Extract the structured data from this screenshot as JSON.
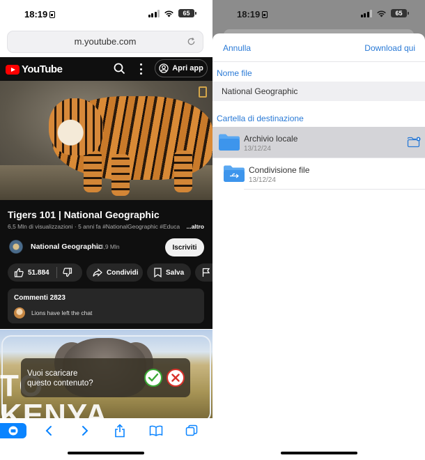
{
  "status": {
    "time": "18:19",
    "battery": "65"
  },
  "browser": {
    "url": "m.youtube.com"
  },
  "youtube": {
    "logo_text": "YouTube",
    "open_app_label": "Apri app",
    "video_title": "Tigers 101 | National Geographic",
    "video_meta": "6,5 Mln di visualizzazioni · 5 anni fa  #NationalGeographic #Educa",
    "more_label": "...altro",
    "channel_name": "National Geographic",
    "channel_subs": "23,9 Mln",
    "subscribe_label": "Iscriviti",
    "like_count": "51.884",
    "share_label": "Condividi",
    "save_label": "Salva",
    "comments_title": "Commenti 2823",
    "comment_text": "Lions have left the chat",
    "thumbnail_text_1": "TO",
    "thumbnail_text_2": "KENYA"
  },
  "download_prompt": {
    "line1": "Vuoi scaricare",
    "line2": "questo contenuto?"
  },
  "sheet": {
    "cancel_label": "Annulla",
    "download_label": "Download qui",
    "filename_label": "Nome file",
    "filename_value": "National Geographic",
    "destination_label": "Cartella di destinazione",
    "folders": [
      {
        "name": "Archivio locale",
        "date": "13/12/24",
        "selected": true
      },
      {
        "name": "Condivisione file",
        "date": "13/12/24",
        "selected": false
      }
    ]
  },
  "colors": {
    "accent": "#2a7ad6",
    "youtube_red": "#ff0000",
    "safari_blue": "#0a84ff"
  }
}
